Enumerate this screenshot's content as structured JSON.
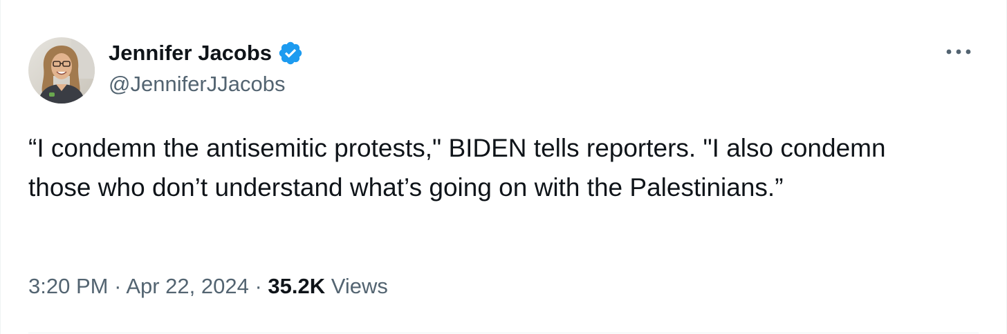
{
  "author": {
    "display_name": "Jennifer Jacobs",
    "handle": "@JenniferJJacobs",
    "verified": true,
    "avatar_icon": "profile-photo"
  },
  "tweet": {
    "text": "“I condemn the antisemitic protests,\" BIDEN tells reporters. \"I also condemn those who don’t understand what’s going on with the Palestinians.”",
    "time": "3:20 PM",
    "separator": "·",
    "date": "Apr 22, 2024",
    "views_count": "35.2K",
    "views_label": "Views"
  },
  "icons": {
    "verified": "verified-badge-icon",
    "more": "more-options-icon"
  },
  "colors": {
    "verified_blue": "#1d9bf0",
    "text_primary": "#0f1419",
    "text_secondary": "#536471",
    "border": "#eff3f4"
  }
}
